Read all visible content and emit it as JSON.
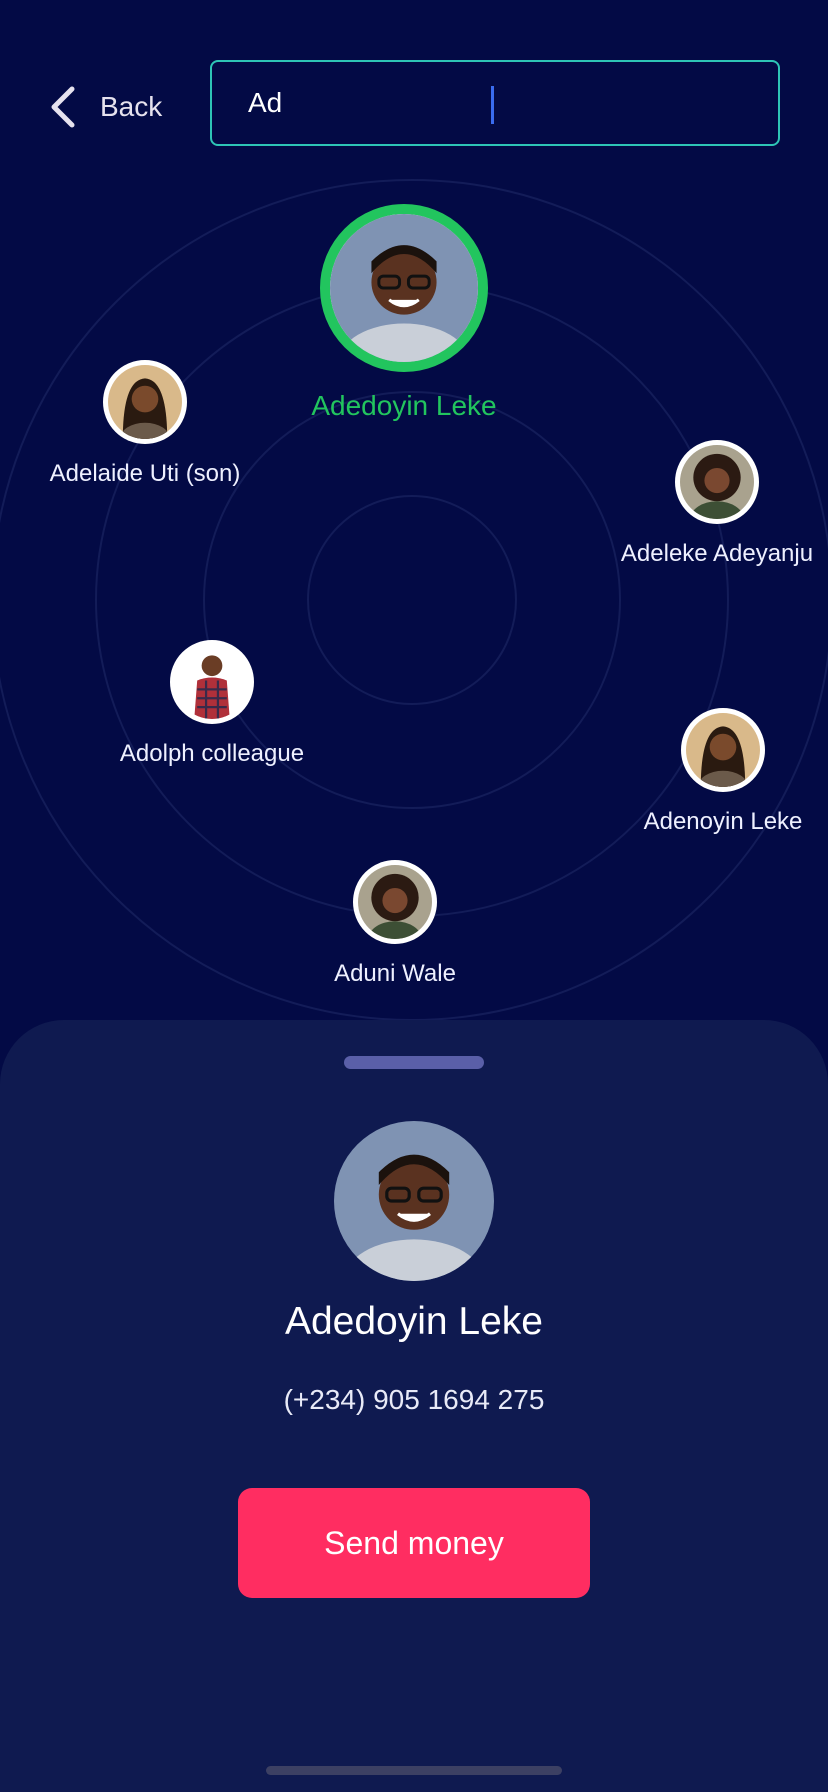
{
  "header": {
    "back_label": "Back",
    "search_value": "Ad",
    "search_border_color": "#2ec5b6"
  },
  "radar": {
    "selected": {
      "name": "Adedoyin Leke",
      "avatar": "young-man-glasses-photo"
    },
    "contacts": [
      {
        "name": "Adelaide Uti (son)",
        "avatar": "woman-smiling-photo"
      },
      {
        "name": "Adeleke Adeyanju",
        "avatar": "woman-curly-hair-photo"
      },
      {
        "name": "Adolph colleague",
        "avatar": "man-plaid-shirt-photo"
      },
      {
        "name": "Adenoyin Leke",
        "avatar": "woman-smiling-photo"
      },
      {
        "name": "Aduni Wale",
        "avatar": "woman-curly-hair-photo"
      }
    ],
    "selected_color": "#22c55e"
  },
  "sheet": {
    "name": "Adedoyin Leke",
    "phone": "(+234) 905 1694 275",
    "send_label": "Send money",
    "send_color": "#ff2d61"
  },
  "colors": {
    "background": "#030a45",
    "sheet": "#0f1a50"
  }
}
